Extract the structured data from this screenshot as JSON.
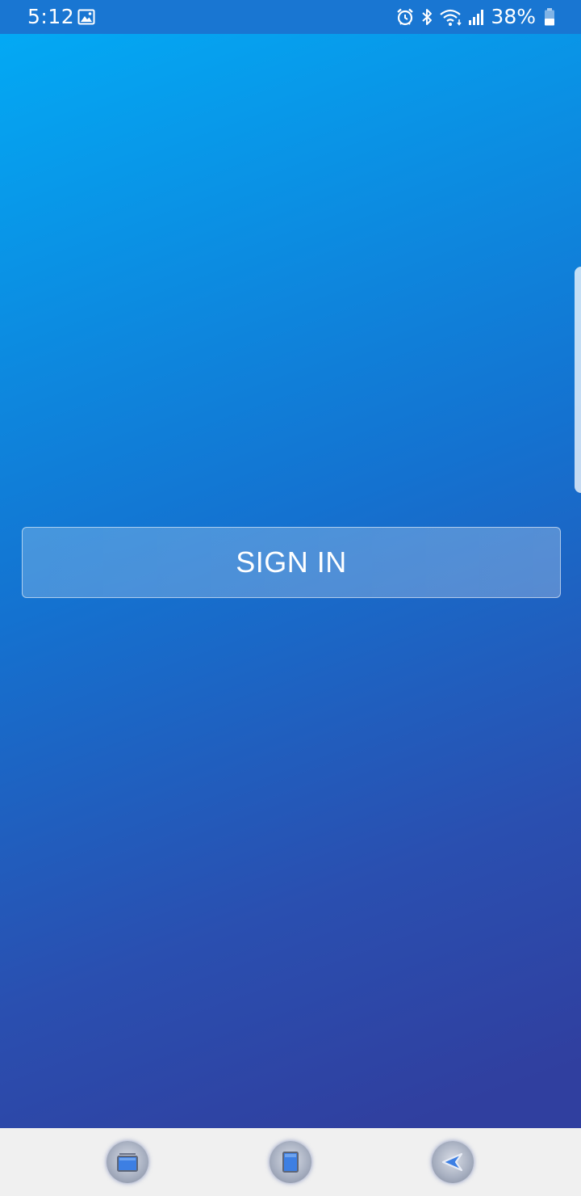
{
  "status_bar": {
    "time": "5:12",
    "battery_percent": "38%",
    "icons": [
      "gallery-icon",
      "alarm-icon",
      "bluetooth-icon",
      "wifi-icon",
      "signal-icon",
      "battery-icon"
    ]
  },
  "main": {
    "signin_label": "SIGN IN"
  },
  "nav_bar": {
    "buttons": [
      "recents-icon",
      "home-icon",
      "back-icon"
    ]
  },
  "colors": {
    "status_bar": "#1976d2",
    "gradient_start": "#03a9f4",
    "gradient_end": "#303f9f",
    "nav_bar": "#f0f0f0"
  }
}
